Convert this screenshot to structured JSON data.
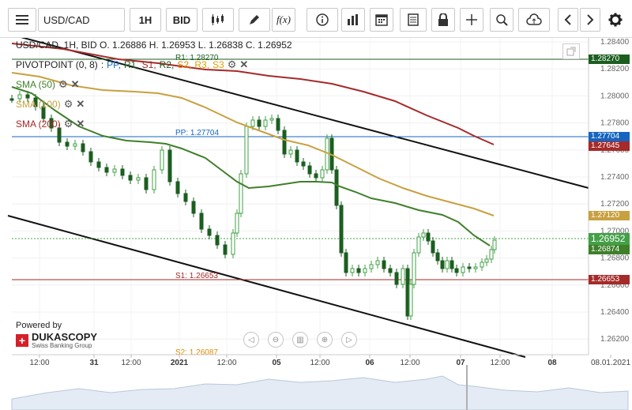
{
  "toolbar": {
    "symbol": "USD/CAD",
    "timeframe": "1H",
    "side": "BID"
  },
  "header": {
    "ohlc": "USD/CAD, 1H, BID   O. 1.26886 H. 1.26953 L. 1.26838 C. 1.26952",
    "pivot_label": "PIVOTPOINT (0, 8)",
    "pivot_items": [
      ":",
      "PP,",
      "R1,",
      "S1,",
      "R2,",
      "S2,",
      "R3,",
      "S3"
    ],
    "sma50": "SMA (50)",
    "sma100": "SMA (100)",
    "sma200": "SMA (200)"
  },
  "colors": {
    "bull": "#43a047",
    "bear": "#1b5e20",
    "sma50": "#3f7f2a",
    "sma100": "#c8a040",
    "sma200": "#a52a2a",
    "pp": "#1565c0",
    "r1": "#1b5e20",
    "s1": "#a52a2a",
    "s2": "#e08a00"
  },
  "levels": {
    "r1": "R1: 1.28270",
    "pp": "PP: 1.27704",
    "s1": "S1: 1.26653",
    "s2": "S2: 1.26087"
  },
  "price_labels": {
    "r1": "1.28270",
    "pp": "1.27704",
    "sma200": "1.27645",
    "sma100": "1.27120",
    "last": "1.26952",
    "sma50": "1.26874",
    "s1": "1.26653"
  },
  "y_ticks": [
    "1.28400",
    "1.28200",
    "1.28000",
    "1.27800",
    "1.27600",
    "1.27400",
    "1.27200",
    "1.27000",
    "1.26800",
    "1.26600",
    "1.26400",
    "1.26200"
  ],
  "x_ticks": [
    "12:00",
    "31",
    "12:00",
    "2021",
    "12:00",
    "05",
    "12:00",
    "06",
    "12:00",
    "07",
    "12:00",
    "08",
    "08.01.2021"
  ],
  "powered": {
    "text": "Powered by",
    "brand": "DUKASCOPY",
    "tagline": "Swiss Banking Group"
  },
  "chart_data": {
    "type": "candlestick",
    "instrument": "USD/CAD",
    "timeframe": "1H",
    "ylim": [
      1.2615,
      1.2845
    ],
    "last": 1.26952,
    "pivots": {
      "R1": 1.2827,
      "PP": 1.27704,
      "S1": 1.26653,
      "S2": 1.26087
    },
    "sma": {
      "SMA 50": 1.26874,
      "SMA 100": 1.2712,
      "SMA 200": 1.27645
    }
  }
}
